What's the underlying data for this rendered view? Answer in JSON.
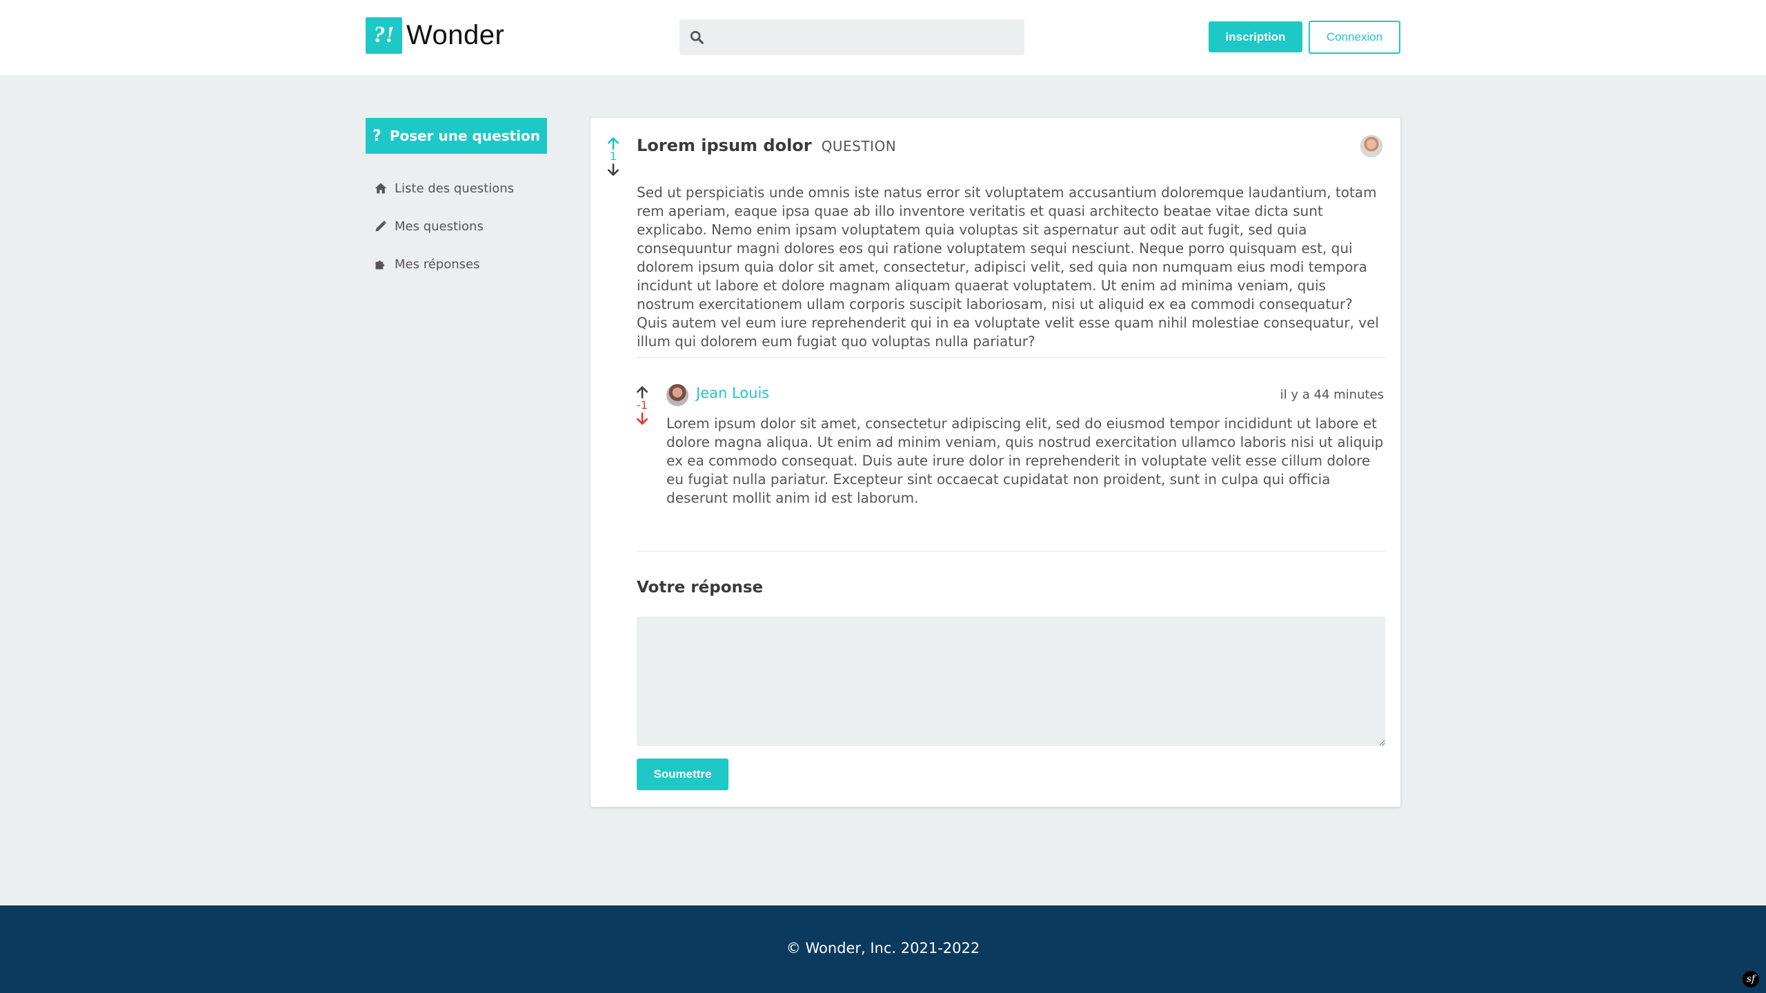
{
  "header": {
    "logo_mark": "?!",
    "logo_text": "Wonder",
    "search_placeholder": "",
    "signup_label": "inscription",
    "login_label": "Connexion"
  },
  "sidebar": {
    "ask_label": "Poser une question",
    "items": [
      {
        "label": "Liste des questions",
        "icon": "home-icon"
      },
      {
        "label": "Mes questions",
        "icon": "pencil-icon"
      },
      {
        "label": "Mes réponses",
        "icon": "puzzle-icon"
      }
    ]
  },
  "question": {
    "title": "Lorem ipsum dolor",
    "tag": "QUESTION",
    "votes": "1",
    "body": "Sed ut perspiciatis unde omnis iste natus error sit voluptatem accusantium doloremque laudantium, totam rem aperiam, eaque ipsa quae ab illo inventore veritatis et quasi architecto beatae vitae dicta sunt explicabo. Nemo enim ipsam voluptatem quia voluptas sit aspernatur aut odit aut fugit, sed quia consequuntur magni dolores eos qui ratione voluptatem sequi nesciunt. Neque porro quisquam est, qui dolorem ipsum quia dolor sit amet, consectetur, adipisci velit, sed quia non numquam eius modi tempora incidunt ut labore et dolore magnam aliquam quaerat voluptatem. Ut enim ad minima veniam, quis nostrum exercitationem ullam corporis suscipit laboriosam, nisi ut aliquid ex ea commodi consequatur? Quis autem vel eum iure reprehenderit qui in ea voluptate velit esse quam nihil molestiae consequatur, vel illum qui dolorem eum fugiat quo voluptas nulla pariatur?"
  },
  "answer": {
    "author": "Jean Louis",
    "time": "il y a 44 minutes",
    "votes": "-1",
    "body": "Lorem ipsum dolor sit amet, consectetur adipiscing elit, sed do eiusmod tempor incididunt ut labore et dolore magna aliqua. Ut enim ad minim veniam, quis nostrud exercitation ullamco laboris nisi ut aliquip ex ea commodo consequat. Duis aute irure dolor in reprehenderit in voluptate velit esse cillum dolore eu fugiat nulla pariatur. Excepteur sint occaecat cupidatat non proident, sunt in culpa qui officia deserunt mollit anim id est laborum."
  },
  "reply": {
    "title": "Votre réponse",
    "value": "",
    "submit_label": "Soumettre"
  },
  "footer": {
    "text": "© Wonder, Inc. 2021-2022",
    "debug_badge": "sf"
  },
  "colors": {
    "accent": "#1ec8c6",
    "footer_bg": "#0b3a5e",
    "page_bg": "#eceff0",
    "downvote_red": "#e53935"
  }
}
